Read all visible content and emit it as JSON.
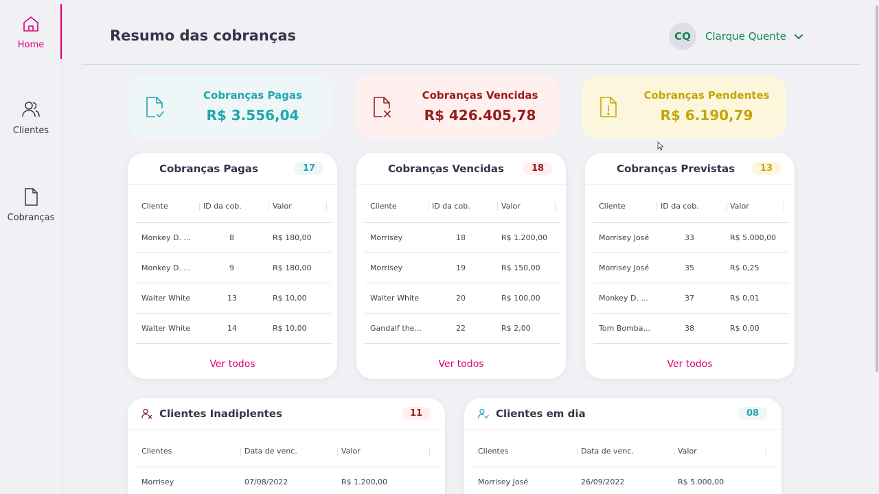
{
  "nav": {
    "home": "Home",
    "clients": "Clientes",
    "charges": "Cobranças"
  },
  "header": {
    "title": "Resumo das cobranças",
    "avatar_initials": "CQ",
    "user_name": "Clarque Quente"
  },
  "summary": {
    "paid": {
      "label": "Cobranças Pagas",
      "value": "R$ 3.556,04",
      "color": "#1FA7AF",
      "bg": "#EEF6F8"
    },
    "overdue": {
      "label": "Cobranças Vencidas",
      "value": "R$ 426.405,78",
      "color": "#971D1D",
      "bg": "#FFEFEF"
    },
    "pending": {
      "label": "Cobranças Pendentes",
      "value": "R$ 6.190,79",
      "color": "#C5A605",
      "bg": "#FCF6DC"
    }
  },
  "tables": {
    "paid": {
      "title": "Cobranças Pagas",
      "count": "17",
      "columns": [
        "Cliente",
        "ID da cob.",
        "Valor"
      ],
      "rows": [
        [
          "Monkey D. ...",
          "8",
          "R$ 180,00"
        ],
        [
          "Monkey D. ...",
          "9",
          "R$ 180,00"
        ],
        [
          "Walter White",
          "13",
          "R$ 10,00"
        ],
        [
          "Walter White",
          "14",
          "R$ 10,00"
        ]
      ],
      "link": "Ver todos"
    },
    "overdue": {
      "title": "Cobranças Vencidas",
      "count": "18",
      "columns": [
        "Cliente",
        "ID da cob.",
        "Valor"
      ],
      "rows": [
        [
          "Morrisey",
          "18",
          "R$ 1.200,00"
        ],
        [
          "Morrisey",
          "19",
          "R$ 150,00"
        ],
        [
          "Walter White",
          "20",
          "R$ 100,00"
        ],
        [
          "Gandalf the...",
          "22",
          "R$ 2,00"
        ]
      ],
      "link": "Ver todos"
    },
    "expected": {
      "title": "Cobranças Previstas",
      "count": "13",
      "columns": [
        "Cliente",
        "ID da cob.",
        "Valor"
      ],
      "rows": [
        [
          "Morrisey José",
          "33",
          "R$ 5.000,00"
        ],
        [
          "Morrisey José",
          "35",
          "R$ 0,25"
        ],
        [
          "Monkey D. ...",
          "37",
          "R$ 0,01"
        ],
        [
          "Tom Bomba...",
          "38",
          "R$ 0,00"
        ]
      ],
      "link": "Ver todos"
    },
    "defaulters": {
      "title": "Clientes Inadiplentes",
      "count": "11",
      "columns": [
        "Clientes",
        "Data de venc.",
        "Valor"
      ],
      "rows": [
        [
          "Morrisey",
          "07/08/2022",
          "R$ 1.200,00"
        ]
      ]
    },
    "uptodate": {
      "title": "Clientes em dia",
      "count": "08",
      "columns": [
        "Clientes",
        "Data de venc.",
        "Valor"
      ],
      "rows": [
        [
          "Morrisey José",
          "26/09/2022",
          "R$ 5.000,00"
        ]
      ]
    }
  },
  "colors": {
    "accent": "#DA0175",
    "green": "#0E8750",
    "teal": "#1FA7AF",
    "red": "#971D1D",
    "yellow": "#C5A605"
  }
}
